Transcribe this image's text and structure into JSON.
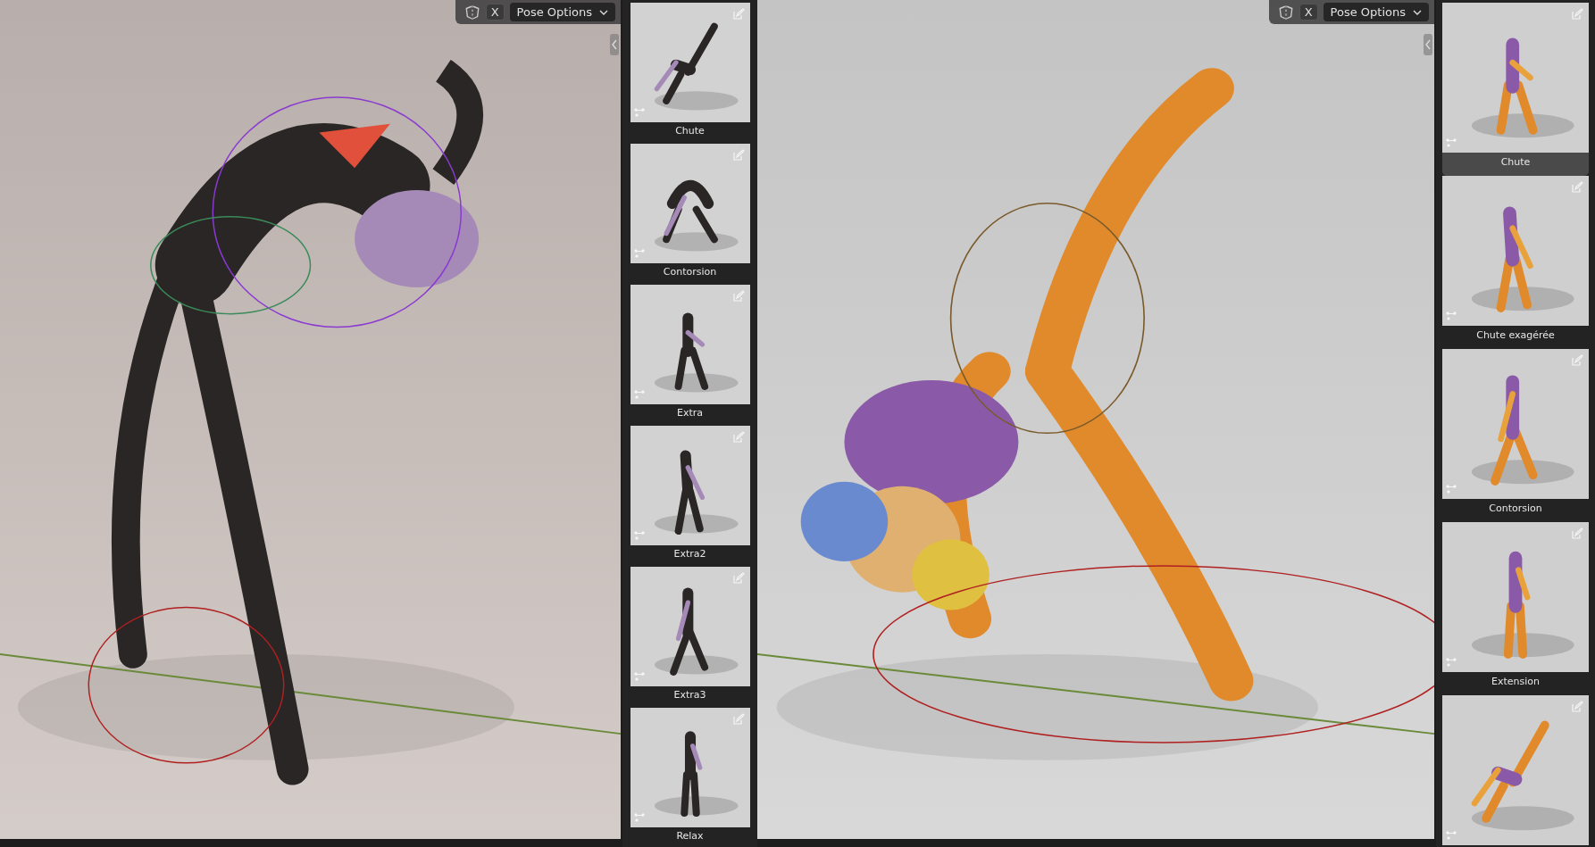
{
  "viewports": [
    {
      "header": {
        "toggle": "X",
        "dropdown": "Pose Options"
      },
      "view": {
        "kind": "picture"
      },
      "pose_library": [
        {
          "label": "Chute",
          "selected": false
        },
        {
          "label": "Contorsion",
          "selected": false
        },
        {
          "label": "Extra",
          "selected": false
        },
        {
          "label": "Extra2",
          "selected": false
        },
        {
          "label": "Extra3",
          "selected": false
        },
        {
          "label": "Relax",
          "selected": false
        }
      ]
    },
    {
      "header": {
        "toggle": "X",
        "dropdown": "Pose Options"
      },
      "view": {
        "kind": "picture"
      },
      "pose_library": [
        {
          "label": "Chute",
          "selected": true
        },
        {
          "label": "Chute exagérée",
          "selected": false
        },
        {
          "label": "Contorsion",
          "selected": false
        },
        {
          "label": "Extension",
          "selected": false
        },
        {
          "selected": false
        }
      ]
    }
  ]
}
